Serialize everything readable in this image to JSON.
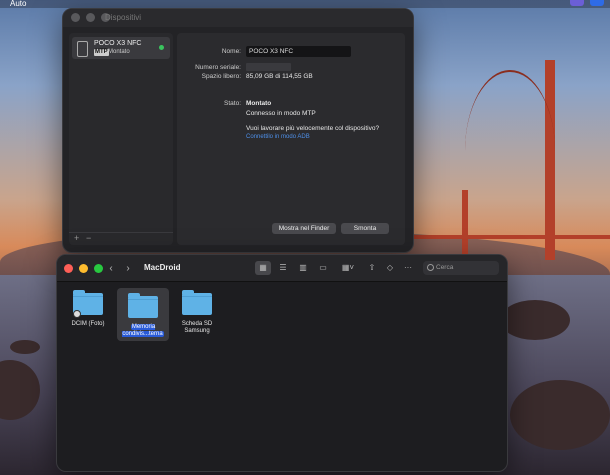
{
  "menubar": {
    "app_name": "Auto"
  },
  "devices_window": {
    "title": "Dispositivi",
    "device": {
      "name": "POCO X3 NFC",
      "badge": "MTP",
      "status": "Montato"
    },
    "footer": {
      "add": "+",
      "remove": "−"
    },
    "details": {
      "name_label": "Nome:",
      "name_value": "POCO X3 NFC",
      "serial_label": "Numero seriale:",
      "free_label": "Spazio libero:",
      "free_value": "85,09 GB di 114,55 GB",
      "state_label": "Stato:",
      "state_value": "Montato",
      "mode_text": "Connesso in modo MTP",
      "question": "Vuoi lavorare più velocemente col dispositivo?",
      "adb_link": "Connettilo in modo ADB"
    },
    "buttons": {
      "show_in_finder": "Mostra nel Finder",
      "unmount": "Smonta"
    }
  },
  "finder": {
    "title": "MacDroid",
    "search_placeholder": "Cerca",
    "folders": [
      {
        "label": "DCIM (Foto)"
      },
      {
        "label": "Memoria condivis...terna"
      },
      {
        "label": "Scheda SD Samsung"
      }
    ]
  },
  "colors": {
    "accent": "#2a5bd8",
    "folder": "#5fb2e6",
    "link": "#4e8fe8",
    "mounted_dot": "#3ac45e"
  }
}
